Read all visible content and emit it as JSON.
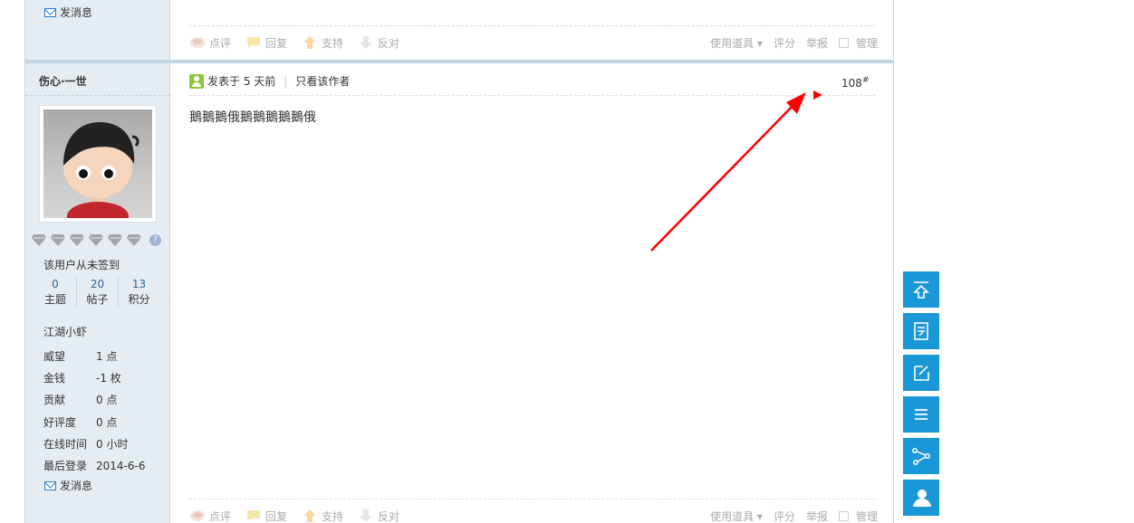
{
  "previous_post": {
    "send_message_label": "发消息",
    "actions": {
      "rate": "点评",
      "reply": "回复",
      "support": "支持",
      "oppose": "反对",
      "use_tool": "使用道具",
      "score": "评分",
      "report": "举报",
      "manage": "管理"
    }
  },
  "author": {
    "name": "伤心·一世",
    "checkin_text": "该用户从未签到",
    "stats": [
      {
        "value": "0",
        "label": "主题"
      },
      {
        "value": "20",
        "label": "帖子"
      },
      {
        "value": "13",
        "label": "积分"
      }
    ],
    "rank": "江湖小虾",
    "info": [
      {
        "key": "威望",
        "value": "1 点"
      },
      {
        "key": "金钱",
        "value": "-1 枚"
      },
      {
        "key": "贡献",
        "value": "0 点"
      },
      {
        "key": "好评度",
        "value": "0 点"
      },
      {
        "key": "在线时间",
        "value": "0 小时"
      },
      {
        "key": "最后登录",
        "value": "2014-6-6"
      }
    ],
    "send_message_label": "发消息",
    "medal_count": 6,
    "help_glyph": "?"
  },
  "post": {
    "posted_time": "发表于 5 天前",
    "author_only": "只看该作者",
    "floor_number": "108",
    "floor_suffix": "#",
    "body": "鵝鵝鵝俄鵝鵝鵝鵝鵝俄",
    "actions": {
      "rate": "点评",
      "reply": "回复",
      "support": "支持",
      "oppose": "反对",
      "use_tool": "使用道具",
      "score": "评分",
      "report": "举报",
      "manage": "管理"
    }
  },
  "side_tools": [
    "back-to-top-icon",
    "post-list-icon",
    "edit-icon",
    "menu-icon",
    "share-icon",
    "user-icon"
  ],
  "colors": {
    "accent": "#1a97d7",
    "sidebar_bg": "#e5edf2",
    "divider": "#c2d5e3",
    "arrow": "#ff0000"
  }
}
